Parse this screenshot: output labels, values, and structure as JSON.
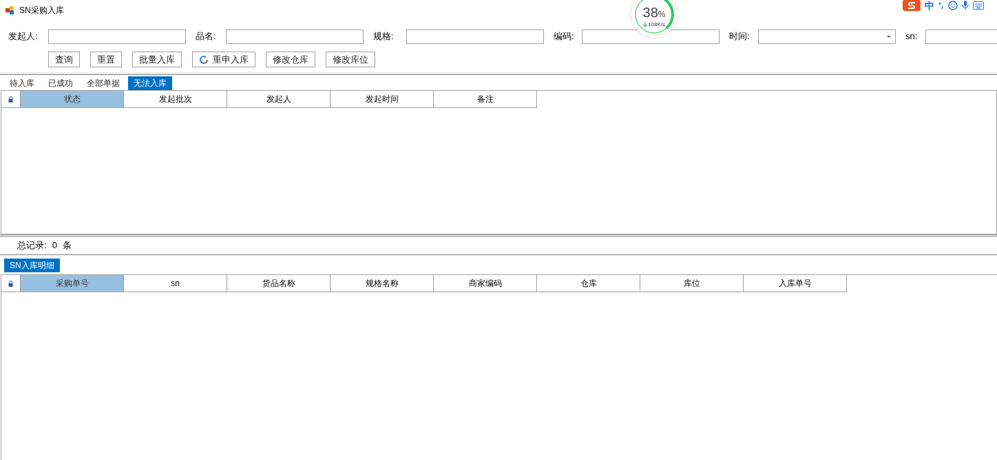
{
  "window": {
    "title": "SN采购入库"
  },
  "filters": [
    {
      "label": "发起人:",
      "kind": "text"
    },
    {
      "label": "品名:",
      "kind": "text"
    },
    {
      "label": "规格:",
      "kind": "text"
    },
    {
      "label": "编码:",
      "kind": "text"
    },
    {
      "label": "时间:",
      "kind": "dropdown"
    },
    {
      "label": "sn:",
      "kind": "text"
    }
  ],
  "buttons": [
    {
      "label": "查询",
      "kind": "plain"
    },
    {
      "label": "重置",
      "kind": "plain"
    },
    {
      "label": "批量入库",
      "kind": "plain"
    },
    {
      "label": "重申入库",
      "kind": "refresh"
    },
    {
      "label": "修改仓库",
      "kind": "plain"
    },
    {
      "label": "修改库位",
      "kind": "plain"
    }
  ],
  "tabs": [
    {
      "label": "待入库",
      "selected": false
    },
    {
      "label": "已成功",
      "selected": false
    },
    {
      "label": "全部单据",
      "selected": false
    },
    {
      "label": "无法入库",
      "selected": true
    }
  ],
  "top_table": {
    "columns": [
      {
        "label": "状态",
        "selected": true
      },
      {
        "label": "发起批次",
        "selected": false
      },
      {
        "label": "发起人",
        "selected": false
      },
      {
        "label": "发起时间",
        "selected": false
      },
      {
        "label": "备注",
        "selected": false
      }
    ]
  },
  "total": {
    "label": "总记录:",
    "count": "0",
    "unit": "条"
  },
  "detail_tabs": [
    {
      "label": "SN入库明细",
      "selected": true
    }
  ],
  "detail_table": {
    "columns": [
      {
        "label": "采购单号",
        "selected": true
      },
      {
        "label": "sn",
        "selected": false
      },
      {
        "label": "货品名称",
        "selected": false
      },
      {
        "label": "规格名称",
        "selected": false
      },
      {
        "label": "商家编码",
        "selected": false
      },
      {
        "label": "仓库",
        "selected": false
      },
      {
        "label": "库位",
        "selected": false
      },
      {
        "label": "入库单号",
        "selected": false
      }
    ]
  },
  "speed_meter": {
    "percent": "38",
    "unit": "%",
    "speed": "108K/s"
  },
  "ime_toolbar": {
    "mode": "中"
  }
}
